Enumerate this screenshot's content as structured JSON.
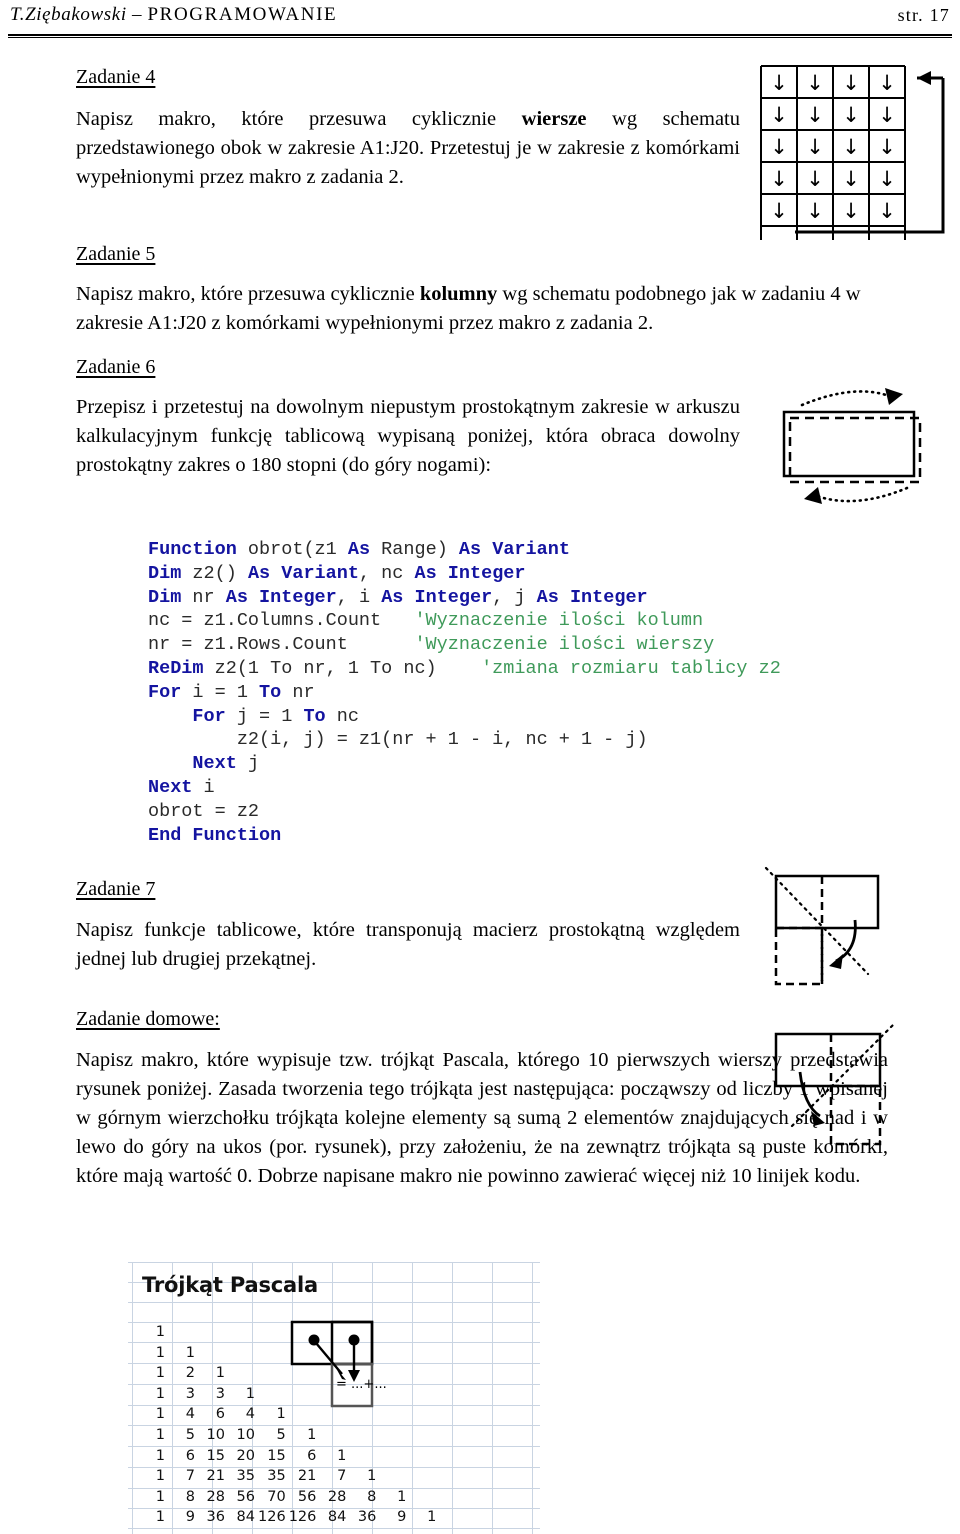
{
  "header": {
    "author": "T.Ziębakowski",
    "dash": " – ",
    "subject": "PROGRAMOWANIE",
    "page": "str. 17"
  },
  "tasks": {
    "z4": {
      "title": "Zadanie 4",
      "text_a": "Napisz makro, które przesuwa cyklicznie ",
      "bold": "wiersze",
      "text_b": " wg schematu przedstawionego obok w zakresie A1:J20. Przetestuj je w zakresie z komórkami wypełnionymi przez makro z zadania 2."
    },
    "z5": {
      "title": "Zadanie 5",
      "text_a": "Napisz makro, które przesuwa cyklicznie ",
      "bold": "kolumny",
      "text_b": " wg schematu podobnego jak w zadaniu 4 w zakresie A1:J20 z komórkami wypełnionymi przez makro z zadania 2."
    },
    "z6": {
      "title": "Zadanie 6",
      "text": "Przepisz i przetestuj na dowolnym niepustym prostokątnym zakresie w arkuszu kalkulacyjnym funkcję tablicową wypisaną poniżej, która obraca dowolny prostokątny zakres o 180 stopni (do góry nogami):"
    },
    "z7": {
      "title": "Zadanie 7",
      "text": "Napisz funkcje tablicowe, które transponują macierz prostokątną względem jednej lub drugiej przekątnej."
    },
    "home": {
      "title": "Zadanie domowe:",
      "text": "Napisz makro, które wypisuje tzw. trójkąt Pascala, którego 10 pierwszych wierszy przedstawia rysunek poniżej. Zasada tworzenia tego trójkąta jest następująca: począwszy od liczby 1 wpisanej w górnym wierzchołku trójkąta kolejne elementy są sumą 2 elementów znajdujących się nad i w lewo do góry na ukos (por. rysunek), przy założeniu, że na zewnątrz trójkąta są puste komórki, które mają wartość 0. Dobrze napisane makro nie powinno zawierać więcej niż 10 linijek kodu."
    }
  },
  "code": {
    "language": "VBA",
    "keyword_color": "#1414a0",
    "comment_color": "#3f9a5a",
    "lines": [
      [
        [
          "kw",
          "Function"
        ],
        [
          "id",
          " obrot(z1 "
        ],
        [
          "kw",
          "As"
        ],
        [
          "id",
          " Range) "
        ],
        [
          "kw",
          "As Variant"
        ]
      ],
      [
        [
          "kw",
          "Dim"
        ],
        [
          "id",
          " z2() "
        ],
        [
          "kw",
          "As Variant"
        ],
        [
          "id",
          ", nc "
        ],
        [
          "kw",
          "As Integer"
        ]
      ],
      [
        [
          "kw",
          "Dim"
        ],
        [
          "id",
          " nr "
        ],
        [
          "kw",
          "As Integer"
        ],
        [
          "id",
          ", i "
        ],
        [
          "kw",
          "As Integer"
        ],
        [
          "id",
          ", j "
        ],
        [
          "kw",
          "As Integer"
        ]
      ],
      [
        [
          "id",
          "nc = z1.Columns.Count   "
        ],
        [
          "cm",
          "'Wyznaczenie ilości kolumn"
        ]
      ],
      [
        [
          "id",
          "nr = z1.Rows.Count      "
        ],
        [
          "cm",
          "'Wyznaczenie ilości wierszy"
        ]
      ],
      [
        [
          "kw",
          "ReDim"
        ],
        [
          "id",
          " z2(1 To nr, 1 To nc)    "
        ],
        [
          "cm",
          "'zmiana rozmiaru tablicy z2"
        ]
      ],
      [
        [
          "kw",
          "For"
        ],
        [
          "id",
          " i = 1 "
        ],
        [
          "kw",
          "To"
        ],
        [
          "id",
          " nr"
        ]
      ],
      [
        [
          "id",
          "    "
        ],
        [
          "kw",
          "For"
        ],
        [
          "id",
          " j = 1 "
        ],
        [
          "kw",
          "To"
        ],
        [
          "id",
          " nc"
        ]
      ],
      [
        [
          "id",
          "        z2(i, j) = z1(nr + 1 - i, nc + 1 - j)"
        ]
      ],
      [
        [
          "id",
          "    "
        ],
        [
          "kw",
          "Next"
        ],
        [
          "id",
          " j"
        ]
      ],
      [
        [
          "kw",
          "Next"
        ],
        [
          "id",
          " i"
        ]
      ],
      [
        [
          "id",
          "obrot = z2"
        ]
      ],
      [
        [
          "kw",
          "End Function"
        ]
      ]
    ]
  },
  "diagrams": {
    "rows_cyclic": {
      "name": "cyclic-row-shift-grid",
      "cols": 4,
      "rows": 5,
      "cell_glyph": "↓",
      "wrap_arrow": "wrap-around-arrow"
    },
    "rotate_180": {
      "name": "rotate-180-rectangle",
      "solid_rect": "original-range",
      "dashed_rect": "rotated-range",
      "arrows": [
        "dotted-arc-top-right",
        "dotted-arc-bottom-left"
      ]
    },
    "transpose_main": {
      "name": "transpose-main-diagonal",
      "solid_rect": "original-range",
      "dashed_rect": "transposed-range",
      "diagonal": "dotted-main-diagonal",
      "arrow": "curved-arrow-down"
    },
    "transpose_anti": {
      "name": "transpose-anti-diagonal",
      "solid_rect": "original-range",
      "dashed_rect": "transposed-range",
      "diagonal": "dotted-anti-diagonal",
      "arrow": "curved-arrow-down"
    }
  },
  "spreadsheet": {
    "title": "Trójkąt Pascala",
    "formula_label": "= ...+...",
    "triangle_rows": [
      [
        1
      ],
      [
        1,
        1
      ],
      [
        1,
        2,
        1
      ],
      [
        1,
        3,
        3,
        1
      ],
      [
        1,
        4,
        6,
        4,
        1
      ],
      [
        1,
        5,
        10,
        10,
        5,
        1
      ],
      [
        1,
        6,
        15,
        20,
        15,
        6,
        1
      ],
      [
        1,
        7,
        21,
        35,
        35,
        21,
        7,
        1
      ],
      [
        1,
        8,
        28,
        56,
        70,
        56,
        28,
        8,
        1
      ],
      [
        1,
        9,
        36,
        84,
        126,
        126,
        84,
        36,
        9,
        1
      ]
    ],
    "grid_line_color": "#c9d4e2"
  }
}
